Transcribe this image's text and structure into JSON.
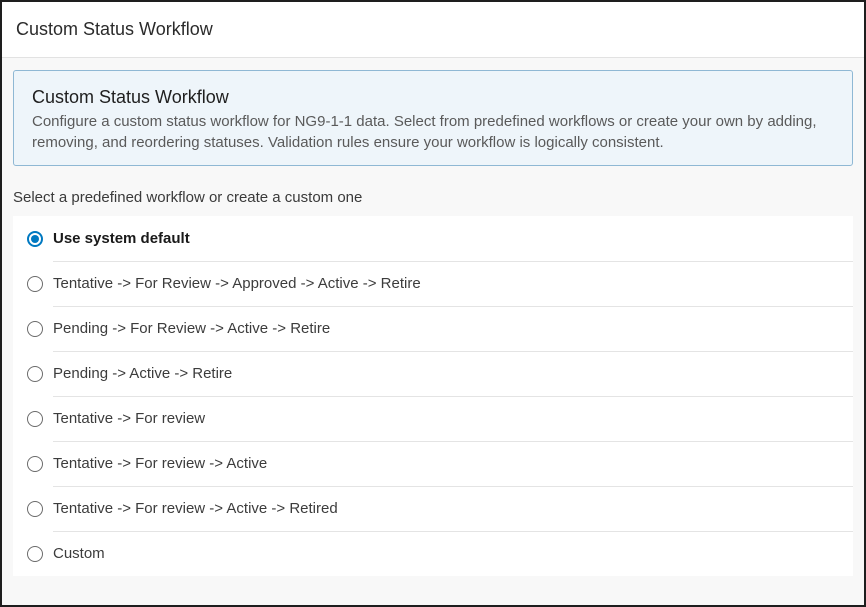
{
  "header": {
    "title": "Custom Status Workflow"
  },
  "info": {
    "title": "Custom Status Workflow",
    "description": "Configure a custom status workflow for NG9-1-1 data. Select from predefined workflows or create your own by adding, removing, and reordering statuses. Validation rules ensure your workflow is logically consistent."
  },
  "selector": {
    "label": "Select a predefined workflow or create a custom one",
    "options": [
      {
        "label": "Use system default",
        "selected": true
      },
      {
        "label": "Tentative -> For Review -> Approved -> Active -> Retire",
        "selected": false
      },
      {
        "label": "Pending -> For Review -> Active -> Retire",
        "selected": false
      },
      {
        "label": "Pending -> Active -> Retire",
        "selected": false
      },
      {
        "label": "Tentative -> For review",
        "selected": false
      },
      {
        "label": "Tentative -> For review -> Active",
        "selected": false
      },
      {
        "label": "Tentative -> For review -> Active -> Retired",
        "selected": false
      },
      {
        "label": "Custom",
        "selected": false
      }
    ]
  },
  "colors": {
    "accent": "#0079c1",
    "info_background": "#eef5fa",
    "info_border": "#8fb8d4"
  }
}
